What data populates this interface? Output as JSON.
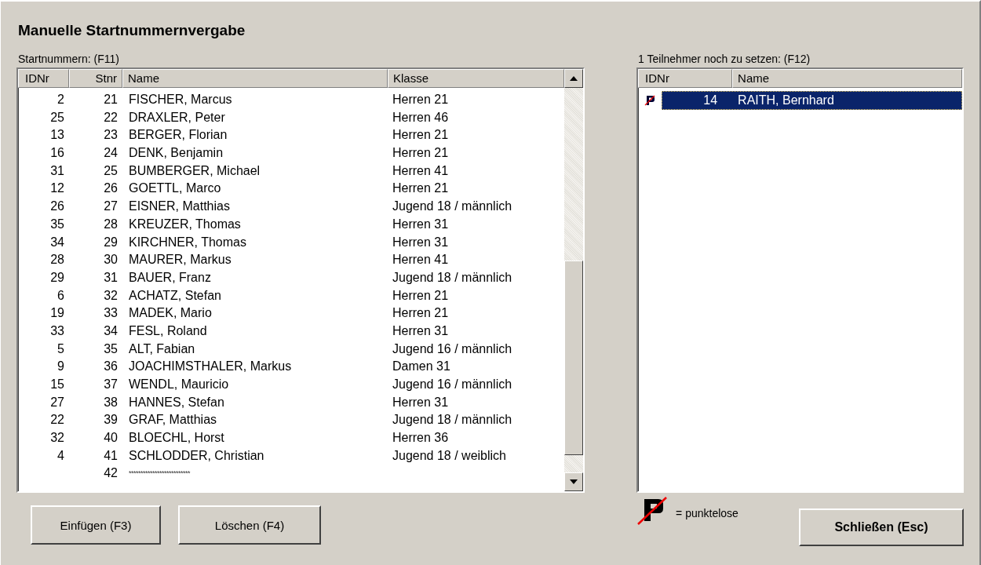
{
  "window": {
    "title": "Manuelle Startnummernvergabe"
  },
  "left_panel": {
    "label": "Startnummern: (F11)",
    "columns": [
      "IDNr",
      "Stnr",
      "Name",
      "Klasse"
    ],
    "rows": [
      {
        "idnr": "2",
        "stnr": "21",
        "name": "FISCHER, Marcus",
        "klasse": "Herren 21"
      },
      {
        "idnr": "25",
        "stnr": "22",
        "name": "DRAXLER, Peter",
        "klasse": "Herren 46"
      },
      {
        "idnr": "13",
        "stnr": "23",
        "name": "BERGER, Florian",
        "klasse": "Herren 21"
      },
      {
        "idnr": "16",
        "stnr": "24",
        "name": "DENK, Benjamin",
        "klasse": "Herren 21"
      },
      {
        "idnr": "31",
        "stnr": "25",
        "name": "BUMBERGER, Michael",
        "klasse": "Herren 41"
      },
      {
        "idnr": "12",
        "stnr": "26",
        "name": "GOETTL, Marco",
        "klasse": "Herren 21"
      },
      {
        "idnr": "26",
        "stnr": "27",
        "name": "EISNER, Matthias",
        "klasse": "Jugend 18 / männlich"
      },
      {
        "idnr": "35",
        "stnr": "28",
        "name": "KREUZER, Thomas",
        "klasse": "Herren 31"
      },
      {
        "idnr": "34",
        "stnr": "29",
        "name": "KIRCHNER, Thomas",
        "klasse": "Herren 31"
      },
      {
        "idnr": "28",
        "stnr": "30",
        "name": "MAURER, Markus",
        "klasse": "Herren 41"
      },
      {
        "idnr": "29",
        "stnr": "31",
        "name": "BAUER, Franz",
        "klasse": "Jugend 18 / männlich"
      },
      {
        "idnr": "6",
        "stnr": "32",
        "name": "ACHATZ, Stefan",
        "klasse": "Herren 21"
      },
      {
        "idnr": "19",
        "stnr": "33",
        "name": "MADEK, Mario",
        "klasse": "Herren 21"
      },
      {
        "idnr": "33",
        "stnr": "34",
        "name": "FESL, Roland",
        "klasse": "Herren 31"
      },
      {
        "idnr": "5",
        "stnr": "35",
        "name": "ALT, Fabian",
        "klasse": "Jugend 16 / männlich"
      },
      {
        "idnr": "9",
        "stnr": "36",
        "name": "JOACHIMSTHALER, Markus",
        "klasse": "Damen 31"
      },
      {
        "idnr": "15",
        "stnr": "37",
        "name": "WENDL, Mauricio",
        "klasse": "Jugend 16 / männlich"
      },
      {
        "idnr": "27",
        "stnr": "38",
        "name": "HANNES, Stefan",
        "klasse": "Herren 31"
      },
      {
        "idnr": "22",
        "stnr": "39",
        "name": "GRAF, Matthias",
        "klasse": "Jugend 18 / männlich"
      },
      {
        "idnr": "32",
        "stnr": "40",
        "name": "BLOECHL, Horst",
        "klasse": "Herren 36"
      },
      {
        "idnr": "4",
        "stnr": "41",
        "name": "SCHLODDER, Christian",
        "klasse": "Jugend 18 / weiblich"
      },
      {
        "stnr": "42",
        "name": "**************************"
      }
    ]
  },
  "right_panel": {
    "label": "1 Teilnehmer noch zu setzen: (F12)",
    "columns": [
      "IDNr",
      "Name"
    ],
    "rows": [
      {
        "idnr": "14",
        "name": "RAITH, Bernhard",
        "punktelos": true,
        "selected": true
      }
    ]
  },
  "legend": {
    "text": "= punktelose"
  },
  "buttons": [
    {
      "label": "Einfügen (F3)",
      "kind": "normal"
    },
    {
      "label": "Löschen (F4)",
      "kind": "normal"
    },
    {
      "label": "Schließen (Esc)",
      "kind": "default"
    }
  ]
}
